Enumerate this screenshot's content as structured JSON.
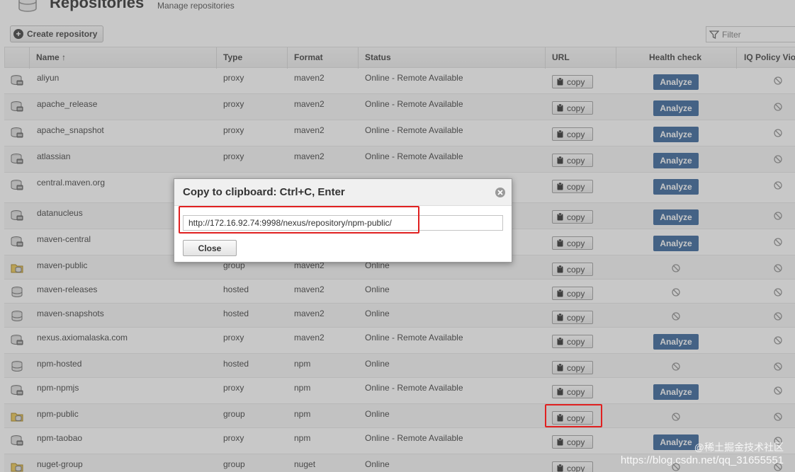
{
  "header": {
    "title": "Repositories",
    "subtitle": "Manage repositories"
  },
  "toolbar": {
    "create_label": "Create repository",
    "filter_placeholder": "Filter"
  },
  "columns": {
    "name": "Name ↑",
    "type": "Type",
    "format": "Format",
    "status": "Status",
    "url": "URL",
    "health": "Health check",
    "iq": "IQ Policy Vio"
  },
  "labels": {
    "copy": "copy",
    "analyze": "Analyze"
  },
  "rows": [
    {
      "name": "aliyun",
      "type": "proxy",
      "format": "maven2",
      "status": "Online - Remote Available",
      "analyze": true,
      "icon": "proxy",
      "h": 37
    },
    {
      "name": "apache_release",
      "type": "proxy",
      "format": "maven2",
      "status": "Online - Remote Available",
      "analyze": true,
      "icon": "proxy",
      "h": 37
    },
    {
      "name": "apache_snapshot",
      "type": "proxy",
      "format": "maven2",
      "status": "Online - Remote Available",
      "analyze": true,
      "icon": "proxy",
      "h": 37
    },
    {
      "name": "atlassian",
      "type": "proxy",
      "format": "maven2",
      "status": "Online - Remote Available",
      "analyze": true,
      "icon": "proxy",
      "h": 37
    },
    {
      "name": "central.maven.org",
      "type": "",
      "format": "",
      "status": "",
      "analyze": true,
      "icon": "proxy",
      "h": 43
    },
    {
      "name": "datanucleus",
      "type": "",
      "format": "",
      "status": "",
      "analyze": true,
      "icon": "proxy",
      "h": 37
    },
    {
      "name": "maven-central",
      "type": "",
      "format": "",
      "status": "",
      "analyze": true,
      "icon": "proxy",
      "h": 37
    },
    {
      "name": "maven-public",
      "type": "group",
      "format": "maven2",
      "status": "Online",
      "analyze": false,
      "icon": "group",
      "h": 34
    },
    {
      "name": "maven-releases",
      "type": "hosted",
      "format": "maven2",
      "status": "Online",
      "analyze": false,
      "icon": "hosted",
      "h": 34
    },
    {
      "name": "maven-snapshots",
      "type": "hosted",
      "format": "maven2",
      "status": "Online",
      "analyze": false,
      "icon": "hosted",
      "h": 34
    },
    {
      "name": "nexus.axiomalaska.com",
      "type": "proxy",
      "format": "maven2",
      "status": "Online - Remote Available",
      "analyze": true,
      "icon": "proxy",
      "h": 37
    },
    {
      "name": "npm-hosted",
      "type": "hosted",
      "format": "npm",
      "status": "Online",
      "analyze": false,
      "icon": "hosted",
      "h": 34
    },
    {
      "name": "npm-npmjs",
      "type": "proxy",
      "format": "npm",
      "status": "Online - Remote Available",
      "analyze": true,
      "icon": "proxy",
      "h": 37
    },
    {
      "name": "npm-public",
      "type": "group",
      "format": "npm",
      "status": "Online",
      "analyze": false,
      "icon": "group",
      "h": 34
    },
    {
      "name": "npm-taobao",
      "type": "proxy",
      "format": "npm",
      "status": "Online - Remote Available",
      "analyze": true,
      "icon": "proxy",
      "h": 37
    },
    {
      "name": "nuget-group",
      "type": "group",
      "format": "nuget",
      "status": "Online",
      "analyze": false,
      "icon": "group",
      "h": 34
    }
  ],
  "dialog": {
    "title": "Copy to clipboard: Ctrl+C, Enter",
    "url": "http://172.16.92.74:9998/nexus/repository/npm-public/",
    "close_label": "Close"
  },
  "watermark": {
    "line1": "@稀土掘金技术社区",
    "line2": "https://blog.csdn.net/qq_31655551"
  },
  "colors": {
    "analyze_bg": "#2a5b93",
    "highlight": "#e02020"
  }
}
